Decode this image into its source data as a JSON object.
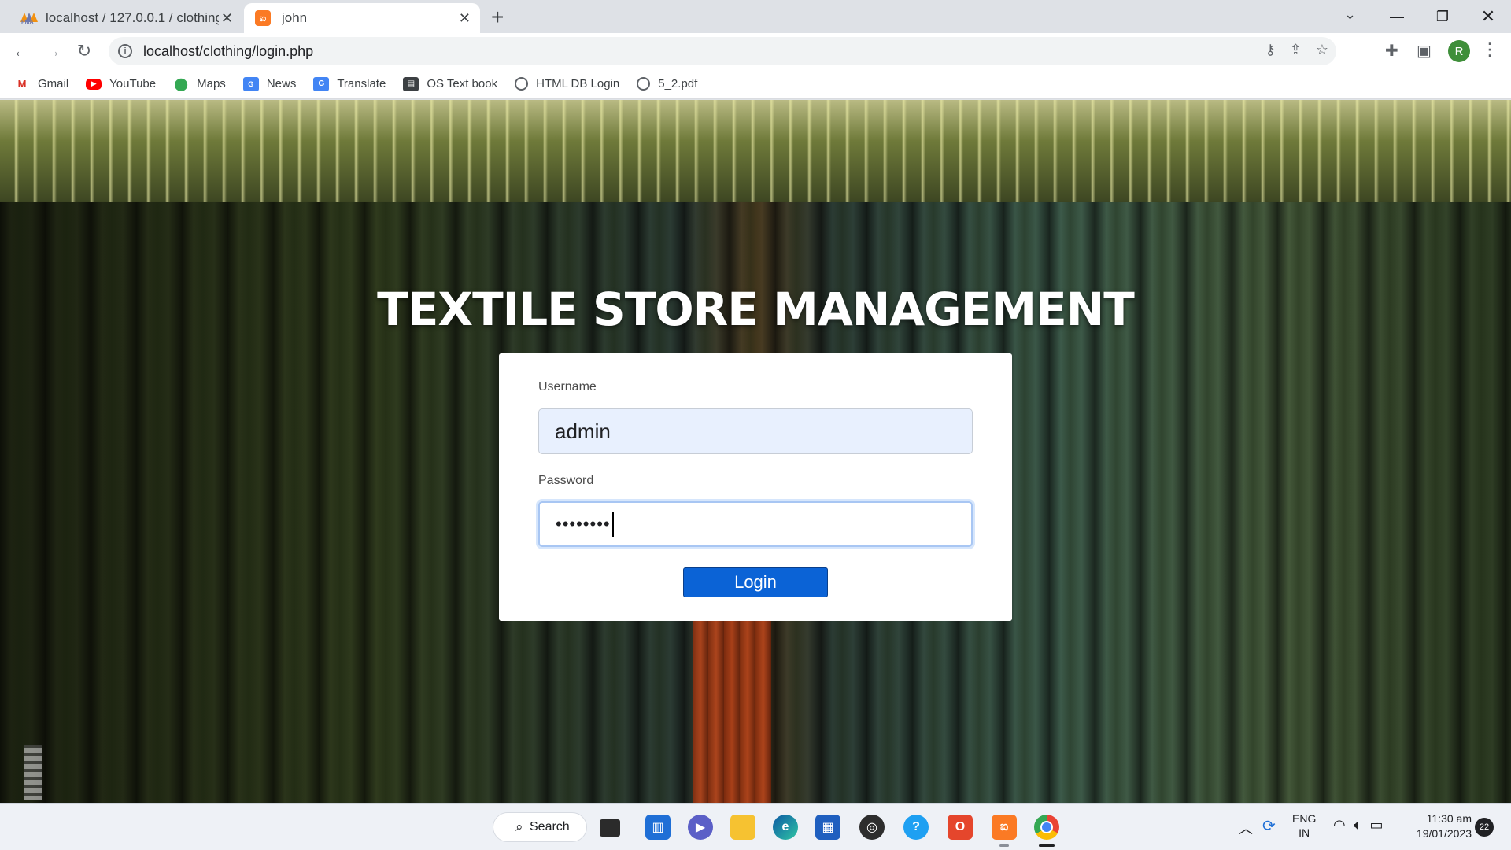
{
  "browser": {
    "tabs": [
      {
        "title": "localhost / 127.0.0.1 / clothing_db",
        "favicon": "phpmyadmin-icon"
      },
      {
        "title": "john",
        "favicon": "xampp-icon"
      }
    ],
    "url": "localhost/clothing/login.php",
    "profile_initial": "R",
    "bookmarks": [
      {
        "label": "Gmail",
        "icon": "gmail-icon"
      },
      {
        "label": "YouTube",
        "icon": "youtube-icon"
      },
      {
        "label": "Maps",
        "icon": "maps-icon"
      },
      {
        "label": "News",
        "icon": "news-icon"
      },
      {
        "label": "Translate",
        "icon": "translate-icon"
      },
      {
        "label": "OS Text book",
        "icon": "book-icon"
      },
      {
        "label": "HTML DB Login",
        "icon": "globe-icon"
      },
      {
        "label": "5_2.pdf",
        "icon": "globe-icon"
      }
    ]
  },
  "page": {
    "heading": "TEXTILE STORE MANAGEMENT",
    "login_form": {
      "username_label": "Username",
      "username_value": "admin",
      "password_label": "Password",
      "password_value_masked": "••••••••",
      "submit_label": "Login"
    }
  },
  "taskbar": {
    "search_label": "Search",
    "language_line1": "ENG",
    "language_line2": "IN",
    "time": "11:30 am",
    "date": "19/01/2023",
    "notification_count": "22"
  },
  "colors": {
    "primary_button": "#0b63d6",
    "autofill_background": "#e8f0fe",
    "focus_ring": "#a8c6f3"
  }
}
